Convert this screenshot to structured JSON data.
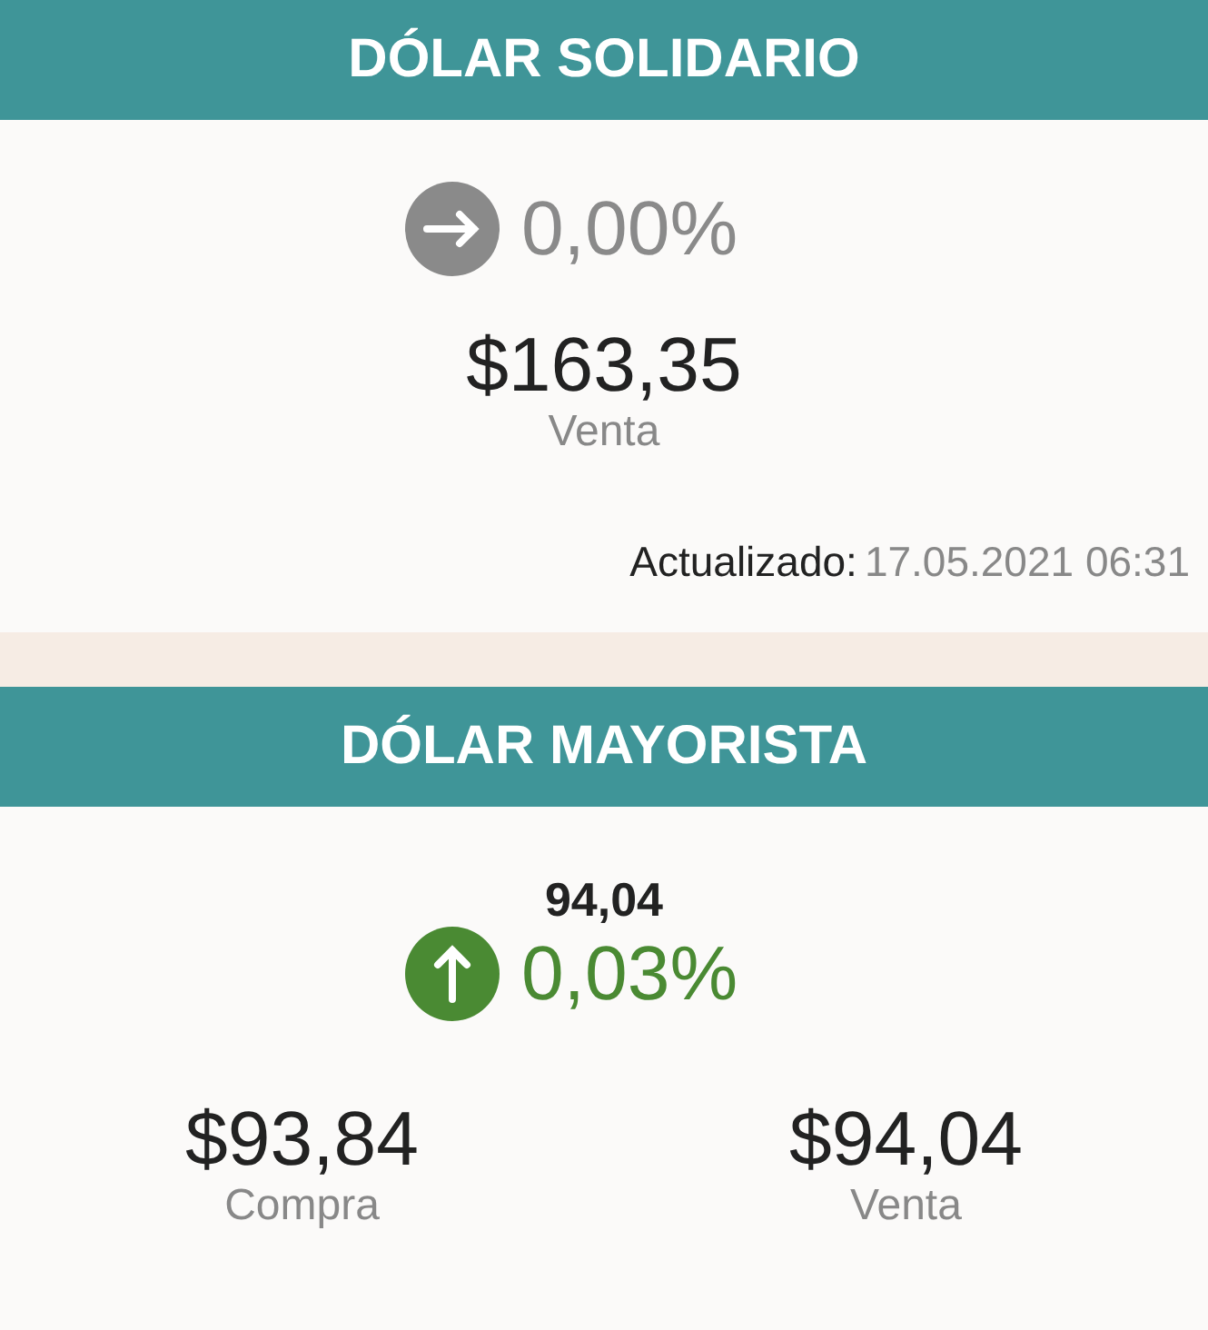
{
  "sections": [
    {
      "title": "DÓLAR SOLIDARIO",
      "trend": {
        "kind": "flat",
        "value": "0,00%"
      },
      "prices": [
        {
          "amount": "$163,35",
          "label": "Venta"
        }
      ],
      "updated": {
        "label": "Actualizado:",
        "value": "17.05.2021 06:31"
      }
    },
    {
      "title": "DÓLAR MAYORISTA",
      "reference": "94,04",
      "trend": {
        "kind": "up",
        "value": "0,03%"
      },
      "prices": [
        {
          "amount": "$93,84",
          "label": "Compra"
        },
        {
          "amount": "$94,04",
          "label": "Venta"
        }
      ]
    }
  ]
}
